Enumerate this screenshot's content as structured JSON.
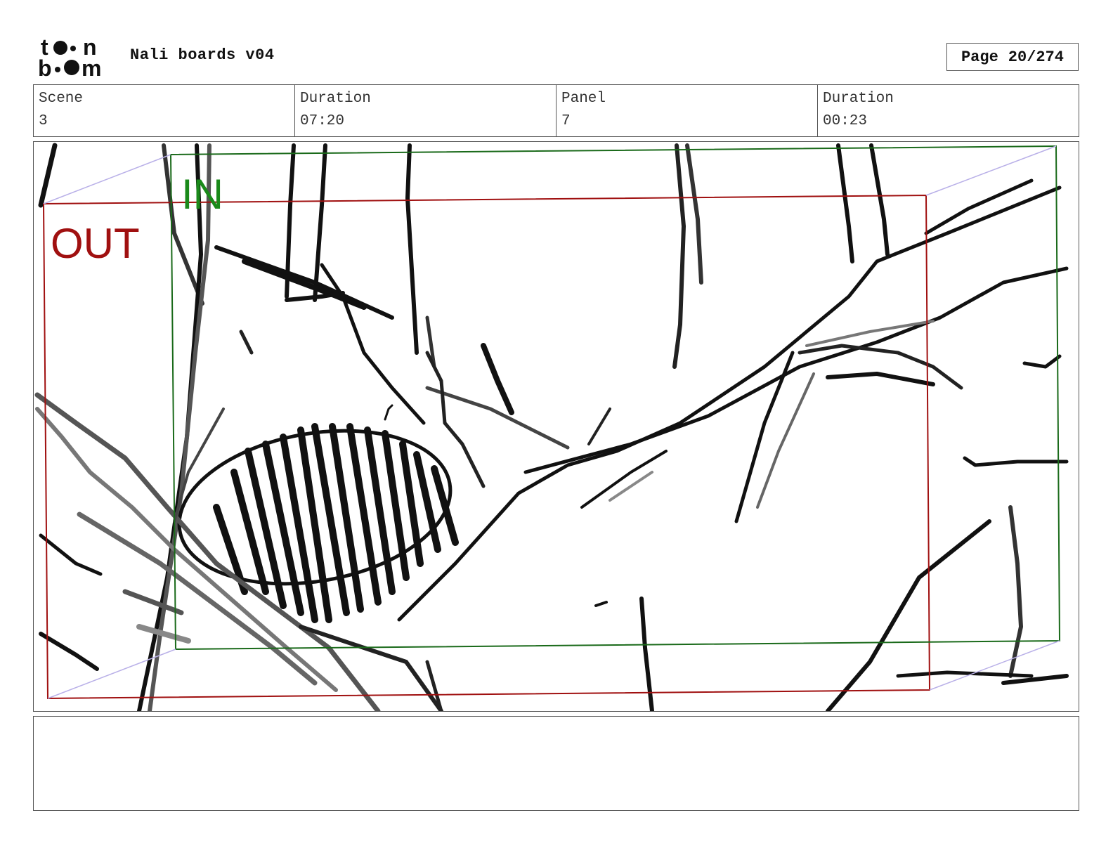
{
  "header": {
    "logo_text": "toon boom",
    "title": "Nali boards v04",
    "page_label": "Page",
    "page_value": "20/274"
  },
  "info": {
    "scene_label": "Scene",
    "scene_value": "3",
    "scene_duration_label": "Duration",
    "scene_duration_value": "07:20",
    "panel_label": "Panel",
    "panel_value": "7",
    "panel_duration_label": "Duration",
    "panel_duration_value": "00:23"
  },
  "panel": {
    "in_label": "IN",
    "out_label": "OUT",
    "in_color": "#1a8a1a",
    "out_color": "#a01010"
  },
  "notes": {
    "text": ""
  }
}
